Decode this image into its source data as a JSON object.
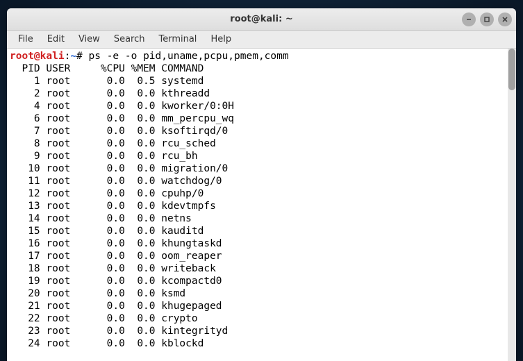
{
  "window": {
    "title": "root@kali: ~"
  },
  "menu": {
    "items": [
      "File",
      "Edit",
      "View",
      "Search",
      "Terminal",
      "Help"
    ]
  },
  "prompt": {
    "user_host": "root@kali",
    "colon": ":",
    "path": "~",
    "hash": "#",
    "command": " ps -e -o pid,uname,pcpu,pmem,comm"
  },
  "ps": {
    "header": "  PID USER     %CPU %MEM COMMAND",
    "rows": [
      {
        "pid": "1",
        "user": "root",
        "cpu": "0.0",
        "mem": "0.5",
        "cmd": "systemd"
      },
      {
        "pid": "2",
        "user": "root",
        "cpu": "0.0",
        "mem": "0.0",
        "cmd": "kthreadd"
      },
      {
        "pid": "4",
        "user": "root",
        "cpu": "0.0",
        "mem": "0.0",
        "cmd": "kworker/0:0H"
      },
      {
        "pid": "6",
        "user": "root",
        "cpu": "0.0",
        "mem": "0.0",
        "cmd": "mm_percpu_wq"
      },
      {
        "pid": "7",
        "user": "root",
        "cpu": "0.0",
        "mem": "0.0",
        "cmd": "ksoftirqd/0"
      },
      {
        "pid": "8",
        "user": "root",
        "cpu": "0.0",
        "mem": "0.0",
        "cmd": "rcu_sched"
      },
      {
        "pid": "9",
        "user": "root",
        "cpu": "0.0",
        "mem": "0.0",
        "cmd": "rcu_bh"
      },
      {
        "pid": "10",
        "user": "root",
        "cpu": "0.0",
        "mem": "0.0",
        "cmd": "migration/0"
      },
      {
        "pid": "11",
        "user": "root",
        "cpu": "0.0",
        "mem": "0.0",
        "cmd": "watchdog/0"
      },
      {
        "pid": "12",
        "user": "root",
        "cpu": "0.0",
        "mem": "0.0",
        "cmd": "cpuhp/0"
      },
      {
        "pid": "13",
        "user": "root",
        "cpu": "0.0",
        "mem": "0.0",
        "cmd": "kdevtmpfs"
      },
      {
        "pid": "14",
        "user": "root",
        "cpu": "0.0",
        "mem": "0.0",
        "cmd": "netns"
      },
      {
        "pid": "15",
        "user": "root",
        "cpu": "0.0",
        "mem": "0.0",
        "cmd": "kauditd"
      },
      {
        "pid": "16",
        "user": "root",
        "cpu": "0.0",
        "mem": "0.0",
        "cmd": "khungtaskd"
      },
      {
        "pid": "17",
        "user": "root",
        "cpu": "0.0",
        "mem": "0.0",
        "cmd": "oom_reaper"
      },
      {
        "pid": "18",
        "user": "root",
        "cpu": "0.0",
        "mem": "0.0",
        "cmd": "writeback"
      },
      {
        "pid": "19",
        "user": "root",
        "cpu": "0.0",
        "mem": "0.0",
        "cmd": "kcompactd0"
      },
      {
        "pid": "20",
        "user": "root",
        "cpu": "0.0",
        "mem": "0.0",
        "cmd": "ksmd"
      },
      {
        "pid": "21",
        "user": "root",
        "cpu": "0.0",
        "mem": "0.0",
        "cmd": "khugepaged"
      },
      {
        "pid": "22",
        "user": "root",
        "cpu": "0.0",
        "mem": "0.0",
        "cmd": "crypto"
      },
      {
        "pid": "23",
        "user": "root",
        "cpu": "0.0",
        "mem": "0.0",
        "cmd": "kintegrityd"
      },
      {
        "pid": "24",
        "user": "root",
        "cpu": "0.0",
        "mem": "0.0",
        "cmd": "kblockd"
      }
    ]
  }
}
